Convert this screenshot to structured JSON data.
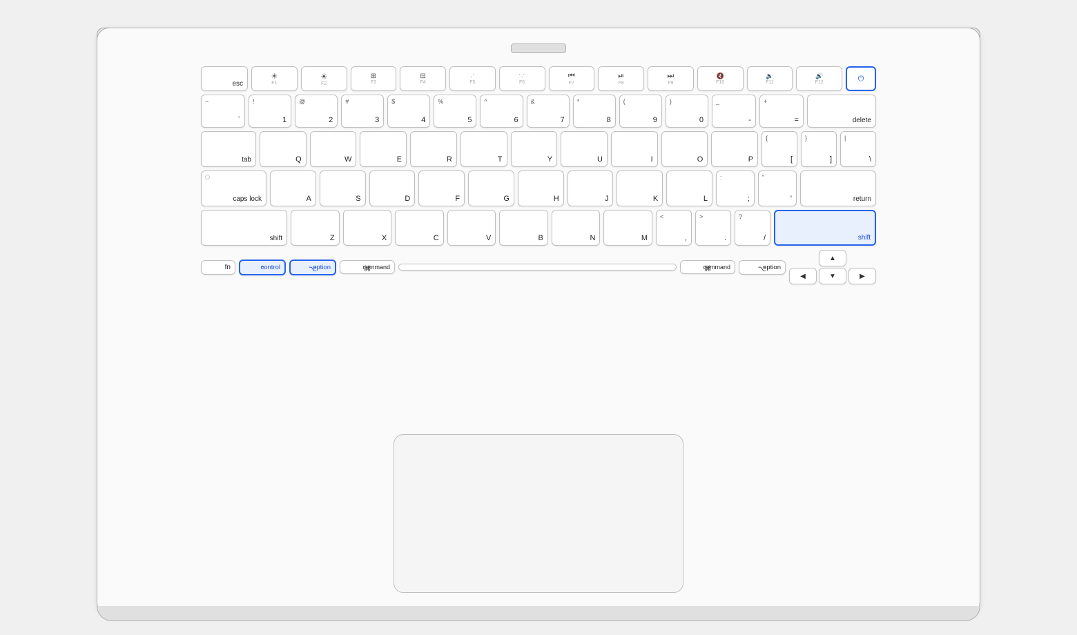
{
  "laptop": {
    "keys": {
      "esc": "esc",
      "f1": "F1",
      "f2": "F2",
      "f3": "F3",
      "f4": "F4",
      "f5": "F5",
      "f6": "F6",
      "f7": "F7",
      "f8": "F8",
      "f9": "F9",
      "f10": "F10",
      "f11": "F11",
      "f12": "F12",
      "grave": "`~",
      "1": "1!",
      "2": "2@",
      "3": "3#",
      "4": "4$",
      "5": "5%",
      "6": "6^",
      "7": "7&",
      "8": "8*",
      "9": "9(",
      "0": "0)",
      "minus": "-_",
      "equal": "=+",
      "delete": "delete",
      "tab": "tab",
      "q": "Q",
      "w": "W",
      "e": "E",
      "r": "R",
      "t": "T",
      "y": "Y",
      "u": "U",
      "i": "I",
      "o": "O",
      "p": "P",
      "bracketL": "[{",
      "bracketR": "]}",
      "backslash": "\\|",
      "capslock": "caps lock",
      "a": "A",
      "s": "S",
      "d": "D",
      "f": "F",
      "g": "G",
      "h": "H",
      "j": "J",
      "k": "K",
      "l": "L",
      "semicolon": ";:",
      "quote": "',\"",
      "return": "return",
      "shiftL": "shift",
      "z": "Z",
      "x": "X",
      "c": "C",
      "v": "V",
      "b": "B",
      "n": "N",
      "m": "M",
      "comma": "<,",
      "period": ">.",
      "slash": "?/",
      "shiftR": "shift",
      "fn": "fn",
      "control": "control",
      "option": "option",
      "commandL": "command",
      "space": "",
      "commandR": "command",
      "optionR": "option",
      "arrowLeft": "◀",
      "arrowUp": "▲",
      "arrowDown": "▼",
      "arrowRight": "▶"
    },
    "highlighted_keys": [
      "control",
      "option",
      "shiftR",
      "power"
    ],
    "icons": {
      "f1": "☀",
      "f2": "☀☀",
      "f3": "⊞",
      "f4": "⊟",
      "f5": "·",
      "f6": "··",
      "f7": "⏮",
      "f8": "⏯",
      "f9": "⏭",
      "f10": "🔇",
      "f11": "🔉",
      "f12": "🔊"
    }
  }
}
